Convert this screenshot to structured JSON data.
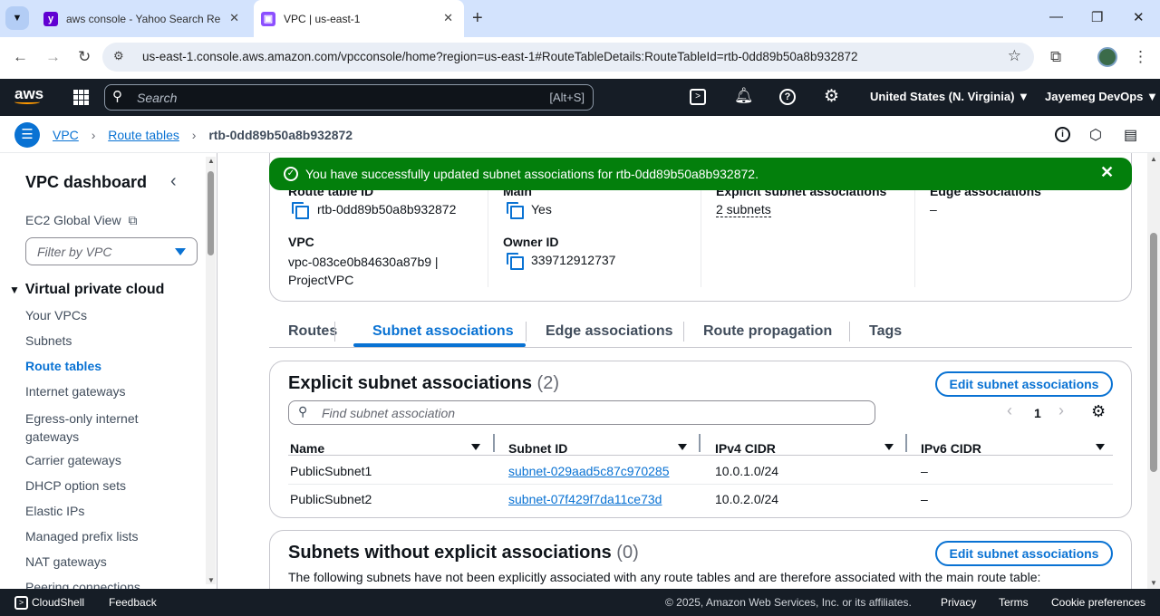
{
  "browser": {
    "tabs": [
      {
        "title": "aws console - Yahoo Search Re",
        "icon": "yahoo-icon",
        "active": false
      },
      {
        "title": "VPC | us-east-1",
        "icon": "vpc-icon",
        "active": true
      }
    ],
    "url": "us-east-1.console.aws.amazon.com/vpcconsole/home?region=us-east-1#RouteTableDetails:RouteTableId=rtb-0dd89b50a8b932872"
  },
  "aws_header": {
    "logo": "aws",
    "search_placeholder": "Search",
    "search_shortcut": "[Alt+S]",
    "region": "United States (N. Virginia)",
    "account": "Jayemeg DevOps"
  },
  "breadcrumb": {
    "items": [
      "VPC",
      "Route tables"
    ],
    "current": "rtb-0dd89b50a8b932872"
  },
  "sidebar": {
    "title": "VPC dashboard",
    "ec2_link": "EC2 Global View",
    "filter_placeholder": "Filter by VPC",
    "section": "Virtual private cloud",
    "items": [
      "Your VPCs",
      "Subnets",
      "Route tables",
      "Internet gateways",
      "Egress-only internet gateways",
      "Carrier gateways",
      "DHCP option sets",
      "Elastic IPs",
      "Managed prefix lists",
      "NAT gateways",
      "Peering connections"
    ],
    "active_item": "Route tables"
  },
  "flash": {
    "message": "You have successfully updated subnet associations for rtb-0dd89b50a8b932872."
  },
  "details": {
    "route_table_id_label": "Route table ID",
    "route_table_id": "rtb-0dd89b50a8b932872",
    "main_label": "Main",
    "main": "Yes",
    "explicit_label": "Explicit subnet associations",
    "explicit": "2 subnets",
    "edge_label": "Edge associations",
    "edge": "–",
    "vpc_label": "VPC",
    "vpc_line1": "vpc-083ce0b84630a87b9 |",
    "vpc_line2": "ProjectVPC",
    "owner_label": "Owner ID",
    "owner": "339712912737"
  },
  "tabs": [
    "Routes",
    "Subnet associations",
    "Edge associations",
    "Route propagation",
    "Tags"
  ],
  "active_tab": "Subnet associations",
  "explicit_table": {
    "title": "Explicit subnet associations",
    "count": "(2)",
    "edit_button": "Edit subnet associations",
    "search_placeholder": "Find subnet association",
    "page": "1",
    "columns": [
      "Name",
      "Subnet ID",
      "IPv4 CIDR",
      "IPv6 CIDR"
    ],
    "rows": [
      {
        "name": "PublicSubnet1",
        "subnet_id": "subnet-029aad5c87c970285",
        "ipv4": "10.0.1.0/24",
        "ipv6": "–"
      },
      {
        "name": "PublicSubnet2",
        "subnet_id": "subnet-07f429f7da11ce73d",
        "ipv4": "10.0.2.0/24",
        "ipv6": "–"
      }
    ]
  },
  "without_table": {
    "title": "Subnets without explicit associations",
    "count": "(0)",
    "edit_button": "Edit subnet associations",
    "description": "The following subnets have not been explicitly associated with any route tables and are therefore associated with the main route table:"
  },
  "footer": {
    "cloudshell": "CloudShell",
    "feedback": "Feedback",
    "copyright": "© 2025, Amazon Web Services, Inc. or its affiliates.",
    "privacy": "Privacy",
    "terms": "Terms",
    "cookies": "Cookie preferences"
  },
  "colors": {
    "aws_nav": "#161d26",
    "link": "#0972d3",
    "success": "#037f0c"
  }
}
